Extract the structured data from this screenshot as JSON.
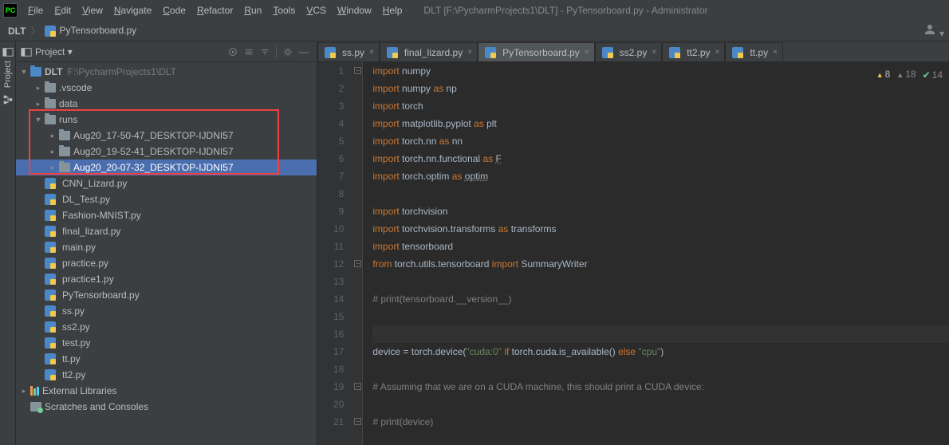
{
  "window": {
    "title": "DLT [F:\\PycharmProjects1\\DLT] - PyTensorboard.py - Administrator"
  },
  "menu": [
    "File",
    "Edit",
    "View",
    "Navigate",
    "Code",
    "Refactor",
    "Run",
    "Tools",
    "VCS",
    "Window",
    "Help"
  ],
  "breadcrumb": {
    "root": "DLT",
    "file": "PyTensorboard.py"
  },
  "project_tool": {
    "title": "Project"
  },
  "tree": {
    "root": {
      "name": "DLT",
      "path": "F:\\PycharmProjects1\\DLT"
    },
    "vscode": ".vscode",
    "data": "data",
    "runs": "runs",
    "run1": "Aug20_17-50-47_DESKTOP-IJDNI57",
    "run2": "Aug20_19-52-41_DESKTOP-IJDNI57",
    "run3": "Aug20_20-07-32_DESKTOP-IJDNI57",
    "files": [
      "CNN_Lizard.py",
      "DL_Test.py",
      "Fashion-MNIST.py",
      "final_lizard.py",
      "main.py",
      "practice.py",
      "practice1.py",
      "PyTensorboard.py",
      "ss.py",
      "ss2.py",
      "test.py",
      "tt.py",
      "tt2.py"
    ],
    "ext_lib": "External Libraries",
    "scratches": "Scratches and Consoles"
  },
  "tabs": [
    {
      "label": "ss.py",
      "active": false
    },
    {
      "label": "final_lizard.py",
      "active": false
    },
    {
      "label": "PyTensorboard.py",
      "active": true
    },
    {
      "label": "ss2.py",
      "active": false
    },
    {
      "label": "tt2.py",
      "active": false
    },
    {
      "label": "tt.py",
      "active": false
    }
  ],
  "analysis": {
    "warnings": "8",
    "weak": "18",
    "typos": "14"
  },
  "code": {
    "lines": [
      {
        "n": 1,
        "h": "<span class='kw'>import</span> numpy"
      },
      {
        "n": 2,
        "h": "<span class='kw'>import</span> numpy <span class='kw'>as</span> np"
      },
      {
        "n": 3,
        "h": "<span class='kw'>import</span> torch"
      },
      {
        "n": 4,
        "h": "<span class='kw'>import</span> matplotlib.pyplot <span class='kw'>as</span> plt"
      },
      {
        "n": 5,
        "h": "<span class='kw'>import</span> torch.nn <span class='kw'>as</span> nn"
      },
      {
        "n": 6,
        "h": "<span class='kw'>import</span> torch.nn.functional <span class='kw'>as</span> <span class='und'>F</span>"
      },
      {
        "n": 7,
        "h": "<span class='kw'>import</span> torch.optim <span class='kw'>as</span> <span class='und'>optim</span>"
      },
      {
        "n": 8,
        "h": ""
      },
      {
        "n": 9,
        "h": "<span class='kw'>import</span> torchvision"
      },
      {
        "n": 10,
        "h": "<span class='kw'>import</span> torchvision.transforms <span class='kw'>as</span> transforms"
      },
      {
        "n": 11,
        "h": "<span class='kw'>import</span> tensorboard"
      },
      {
        "n": 12,
        "h": "<span class='kw'>from</span> torch.utils.tensorboard <span class='kw'>import</span> SummaryWriter"
      },
      {
        "n": 13,
        "h": ""
      },
      {
        "n": 14,
        "h": "<span class='cm'># print(tensorboard.__version__)</span>"
      },
      {
        "n": 15,
        "h": ""
      },
      {
        "n": 16,
        "h": "",
        "current": true
      },
      {
        "n": 17,
        "h": "device = torch.device(<span class='str'>\"cuda:0\"</span> <span class='kw'>if</span> torch.cuda.is_available() <span class='kw'>else</span> <span class='str'>\"cpu\"</span>)"
      },
      {
        "n": 18,
        "h": ""
      },
      {
        "n": 19,
        "h": "<span class='cm'># Assuming that we are on a CUDA machine, this should print a CUDA device:</span>"
      },
      {
        "n": 20,
        "h": ""
      },
      {
        "n": 21,
        "h": "<span class='cm'># print(device)</span>"
      }
    ]
  }
}
